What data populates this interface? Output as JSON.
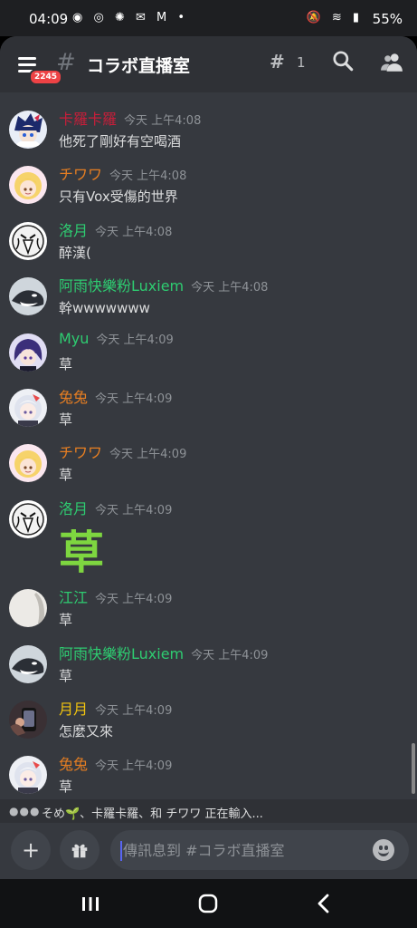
{
  "status_bar": {
    "time": "04:09",
    "left_icons": "◉ ◎ ✺ ✉ M •",
    "right_icons": "🔕 ≋ ▮",
    "battery": "55%"
  },
  "header": {
    "menu_badge": "2245",
    "hash": "#",
    "channel_title": "コラボ直播室",
    "threads_count": "1"
  },
  "messages": [
    {
      "author": "卡羅卡羅",
      "time": "今天 上午4:08",
      "text": "他死了剛好有空喝酒",
      "color": "#c81e3a",
      "avatar": "blue-hair-avatar"
    },
    {
      "author": "チワワ",
      "time": "今天 上午4:08",
      "text": "只有Vox受傷的世界",
      "color": "#e67e22",
      "avatar": "blonde-avatar"
    },
    {
      "author": "洛月",
      "time": "今天 上午4:08",
      "text": "醉漢(",
      "color": "#2ecc71",
      "avatar": "mask-avatar"
    },
    {
      "author": "阿雨快樂粉Luxiem",
      "time": "今天 上午4:08",
      "text": "幹wwwwwww",
      "color": "#2ecc71",
      "avatar": "orca-avatar"
    },
    {
      "author": "Myu",
      "time": "今天 上午4:09",
      "text": "草",
      "color": "#2ecc71",
      "avatar": "purple-hair-avatar"
    },
    {
      "author": "兔兔",
      "time": "今天 上午4:09",
      "text": "草",
      "color": "#e67e22",
      "avatar": "white-hair-avatar"
    },
    {
      "author": "チワワ",
      "time": "今天 上午4:09",
      "text": "草",
      "color": "#e67e22",
      "avatar": "blonde-avatar"
    },
    {
      "author": "洛月",
      "time": "今天 上午4:09",
      "text": "草",
      "color": "#2ecc71",
      "avatar": "mask-avatar",
      "big": true
    },
    {
      "author": "江江",
      "time": "今天 上午4:09",
      "text": "草",
      "color": "#2ecc71",
      "avatar": "pale-avatar"
    },
    {
      "author": "阿雨快樂粉Luxiem",
      "time": "今天 上午4:09",
      "text": "草",
      "color": "#2ecc71",
      "avatar": "orca-avatar"
    },
    {
      "author": "月月",
      "time": "今天 上午4:09",
      "text": "怎麼又來",
      "color": "#f1c40f",
      "avatar": "dark-photo-avatar"
    },
    {
      "author": "兔兔",
      "time": "今天 上午4:09",
      "text": "草",
      "color": "#e67e22",
      "avatar": "white-hair-avatar"
    }
  ],
  "typing": {
    "text": "そめ🌱、卡羅卡羅、和 チワワ 正在輸入..."
  },
  "input": {
    "placeholder": "傳訊息到 #コラボ直播室"
  },
  "colors": {
    "background": "#36393f",
    "header": "#2f3136",
    "accent": "#5865f2",
    "badge": "#ed4245"
  }
}
